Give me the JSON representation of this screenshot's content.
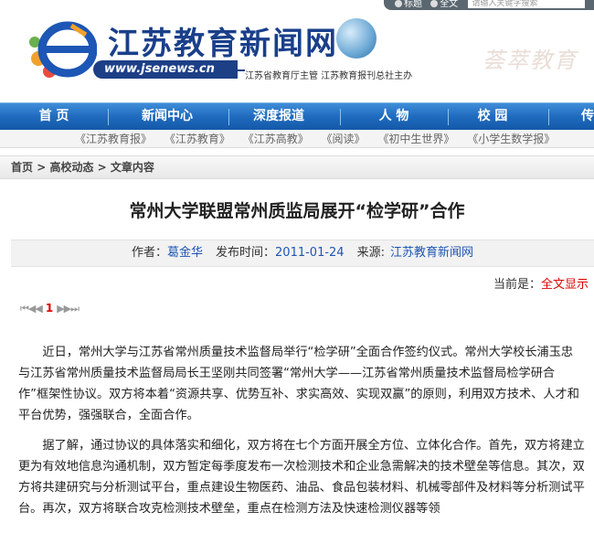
{
  "header": {
    "site_title": "江苏教育新闻网",
    "url": "www.jsenews.cn",
    "sponsor": "江苏省教育厅主管  江苏教育报刊总社主办",
    "slogan": "荟萃教育"
  },
  "search": {
    "option_title": "标题",
    "option_fulltext": "全文",
    "placeholder": "谓输入关键字搜索"
  },
  "nav": {
    "items": [
      "首 页",
      "新闻中心",
      "深度报道",
      "人 物",
      "校 园",
      "传"
    ]
  },
  "subnav": {
    "items": [
      "《江苏教育报》",
      "《江苏教育》",
      "《江苏高教》",
      "《阅读》",
      "《初中生世界》",
      "《小学生数学报》"
    ]
  },
  "breadcrumb": {
    "home": "首页",
    "sep1": " > ",
    "section": "高校动态",
    "sep2": " > ",
    "current": "文章内容"
  },
  "article": {
    "title": "常州大学联盟常州质监局展开“检学研”合作",
    "author_label": "作者：",
    "author": "葛金华",
    "time_label": "发布时间：",
    "time": "2011-01-24",
    "source_label": "来源:",
    "source": "江苏教育新闻网",
    "current_label": "当前是：",
    "current_mode": "全文显示",
    "pager_first": "⏮",
    "pager_prev": "◀◀",
    "page_num": "1",
    "pager_next": "▶▶",
    "pager_last": "⏭",
    "paragraphs": [
      "近日，常州大学与江苏省常州质量技术监督局举行“检学研”全面合作签约仪式。常州大学校长浦玉忠与江苏省常州质量技术监督局局长王坚刚共同签署“常州大学——江苏省常州质量技术监督局检学研合作”框架性协议。双方将本着“资源共享、优势互补、求实高效、实现双赢”的原则，利用双方技术、人才和平台优势，强强联合，全面合作。",
      "据了解，通过协议的具体落实和细化，双方将在七个方面开展全方位、立体化合作。首先，双方将建立更为有效地信息沟通机制，双方暂定每季度发布一次检测技术和企业急需解决的技术壁垒等信息。其次，双方将共建研究与分析测试平台，重点建设生物医药、油品、食品包装材料、机械零部件及材料等分析测试平台。再次，双方将联合攻克检测技术壁垒，重点在检测方法及快速检测仪器等领"
    ]
  }
}
